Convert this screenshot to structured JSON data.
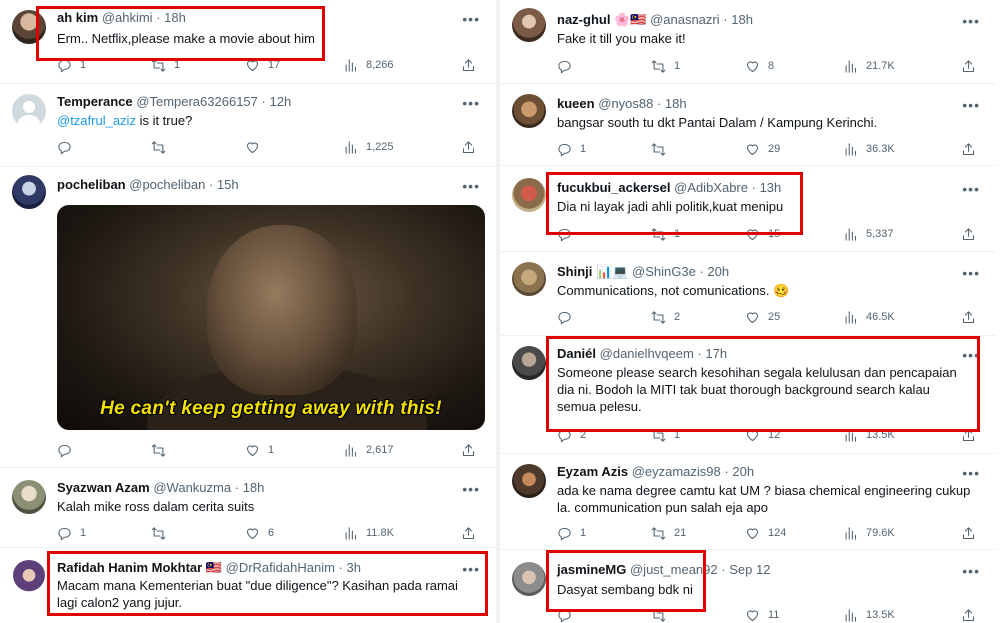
{
  "left_column": {
    "tweets": [
      {
        "name": "ah kim",
        "handle": "@ahkimi",
        "time": "18h",
        "text": "Erm.. Netflix,please make a movie about him",
        "replies": "1",
        "retweets": "1",
        "likes": "17",
        "views": "8,266"
      },
      {
        "name": "Temperance",
        "handle": "@Tempera63266157",
        "time": "12h",
        "mention": "@tzafrul_aziz",
        "text": " is it true?",
        "replies": "",
        "retweets": "",
        "likes": "",
        "views": "1,225"
      },
      {
        "name": "pocheliban",
        "handle": "@pocheliban",
        "time": "15h",
        "gif_caption": "He can't keep getting away with this!",
        "replies": "",
        "retweets": "",
        "likes": "1",
        "views": "2,617"
      },
      {
        "name": "Syazwan Azam",
        "handle": "@Wankuzma",
        "time": "18h",
        "text": "Kalah mike ross dalam cerita suits",
        "replies": "1",
        "retweets": "",
        "likes": "6",
        "views": "11.8K"
      },
      {
        "name": "Rafidah Hanim Mokhtar",
        "flag": "🇲🇾",
        "handle": "@DrRafidahHanim",
        "time": "3h",
        "text": "Macam mana Kementerian buat \"due diligence\"? Kasihan pada ramai lagi calon2 yang jujur."
      }
    ]
  },
  "right_column": {
    "tweets": [
      {
        "name": "naz-ghul",
        "emoji": "🌸🇲🇾",
        "handle": "@anasnazri",
        "time": "18h",
        "text": "Fake it till you make it!",
        "replies": "",
        "retweets": "1",
        "likes": "8",
        "views": "21.7K"
      },
      {
        "name": "kueen",
        "handle": "@nyos88",
        "time": "18h",
        "text": "bangsar south tu dkt Pantai Dalam / Kampung Kerinchi.",
        "replies": "1",
        "retweets": "",
        "likes": "29",
        "views": "36.3K"
      },
      {
        "name": "fucukbui_ackersel",
        "handle": "@AdibXabre",
        "time": "13h",
        "text": "Dia ni layak jadi ahli politik,kuat menipu",
        "replies": "",
        "retweets": "1",
        "likes": "15",
        "views": "5,337"
      },
      {
        "name": "Shinji",
        "emoji": "📊💻",
        "handle": "@ShinG3e",
        "time": "20h",
        "text": "Communications, not comunications. 🥴",
        "replies": "",
        "retweets": "2",
        "likes": "25",
        "views": "46.5K"
      },
      {
        "name": "Daniél",
        "handle": "@danielhvqeem",
        "time": "17h",
        "text": "Someone please search kesohihan segala kelulusan dan pencapaian dia ni. Bodoh la MITI tak buat thorough background search kalau semua pelesu.",
        "replies": "2",
        "retweets": "1",
        "likes": "12",
        "views": "13.5K"
      },
      {
        "name": "Eyzam Azis",
        "handle": "@eyzamazis98",
        "time": "20h",
        "text": "ada ke nama degree camtu kat UM ? biasa chemical engineering cukup la. communication pun salah eja apo",
        "replies": "1",
        "retweets": "21",
        "likes": "124",
        "views": "79.6K"
      },
      {
        "name": "jasmineMG",
        "handle": "@just_mean92",
        "time": "Sep 12",
        "text": "Dasyat sembang bdk ni",
        "replies": "",
        "retweets": "",
        "likes": "11",
        "views": "13.5K"
      }
    ]
  },
  "icons": {
    "reply": "reply-icon",
    "retweet": "retweet-icon",
    "like": "heart-icon",
    "views": "views-icon",
    "share": "share-icon",
    "more": "more-icon"
  },
  "colors": {
    "highlight": "#e00000",
    "mention": "#1d9bf0",
    "muted": "#536471"
  }
}
